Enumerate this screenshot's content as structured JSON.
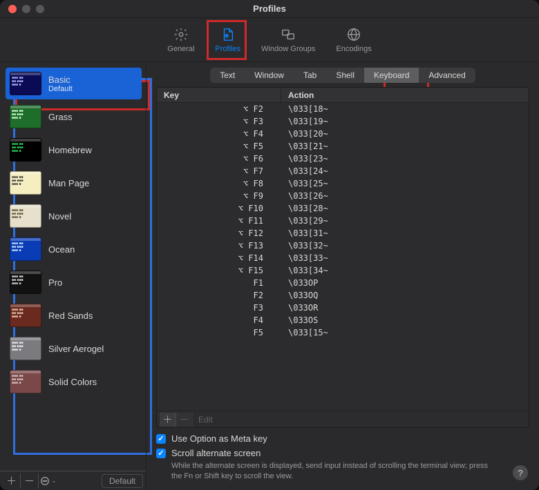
{
  "window": {
    "title": "Profiles"
  },
  "toolbar": {
    "items": [
      {
        "id": "general",
        "label": "General"
      },
      {
        "id": "profiles",
        "label": "Profiles",
        "active": true
      },
      {
        "id": "window-groups",
        "label": "Window Groups"
      },
      {
        "id": "encodings",
        "label": "Encodings"
      }
    ]
  },
  "sidebar": {
    "items": [
      {
        "name": "Basic",
        "sub": "Default",
        "selected": true,
        "swatch": {
          "bg": "#0a0a55",
          "fg": "#bcbcff"
        }
      },
      {
        "name": "Grass",
        "swatch": {
          "bg": "#1e6d2b",
          "fg": "#d6ffd6"
        }
      },
      {
        "name": "Homebrew",
        "swatch": {
          "bg": "#000000",
          "fg": "#2ee05a"
        }
      },
      {
        "name": "Man Page",
        "swatch": {
          "bg": "#f5eec0",
          "fg": "#333333"
        }
      },
      {
        "name": "Novel",
        "swatch": {
          "bg": "#e6e0cc",
          "fg": "#5a4a2a"
        }
      },
      {
        "name": "Ocean",
        "swatch": {
          "bg": "#0a3db5",
          "fg": "#cfe3ff"
        }
      },
      {
        "name": "Pro",
        "swatch": {
          "bg": "#111111",
          "fg": "#dddddd"
        }
      },
      {
        "name": "Red Sands",
        "swatch": {
          "bg": "#6a2a1f",
          "fg": "#f0d0b6"
        }
      },
      {
        "name": "Silver Aerogel",
        "swatch": {
          "bg": "#7a7a7f",
          "fg": "#efefef"
        }
      },
      {
        "name": "Solid Colors",
        "swatch": {
          "bg": "#7a4848",
          "fg": "#d8c8c8"
        }
      }
    ],
    "footer": {
      "default_btn": "Default"
    }
  },
  "panel": {
    "seg": [
      {
        "label": "Text"
      },
      {
        "label": "Window"
      },
      {
        "label": "Tab"
      },
      {
        "label": "Shell"
      },
      {
        "label": "Keyboard",
        "active": true
      },
      {
        "label": "Advanced"
      }
    ],
    "table": {
      "headers": {
        "key": "Key",
        "action": "Action"
      },
      "rows": [
        {
          "key": "⌥ F2",
          "action": "\\033[18~"
        },
        {
          "key": "⌥ F3",
          "action": "\\033[19~"
        },
        {
          "key": "⌥ F4",
          "action": "\\033[20~"
        },
        {
          "key": "⌥ F5",
          "action": "\\033[21~"
        },
        {
          "key": "⌥ F6",
          "action": "\\033[23~"
        },
        {
          "key": "⌥ F7",
          "action": "\\033[24~"
        },
        {
          "key": "⌥ F8",
          "action": "\\033[25~"
        },
        {
          "key": "⌥ F9",
          "action": "\\033[26~"
        },
        {
          "key": "⌥ F10",
          "action": "\\033[28~"
        },
        {
          "key": "⌥ F11",
          "action": "\\033[29~"
        },
        {
          "key": "⌥ F12",
          "action": "\\033[31~"
        },
        {
          "key": "⌥ F13",
          "action": "\\033[32~"
        },
        {
          "key": "⌥ F14",
          "action": "\\033[33~"
        },
        {
          "key": "⌥ F15",
          "action": "\\033[34~"
        },
        {
          "key": "F1",
          "action": "\\033OP"
        },
        {
          "key": "F2",
          "action": "\\033OQ"
        },
        {
          "key": "F3",
          "action": "\\033OR"
        },
        {
          "key": "F4",
          "action": "\\033OS"
        },
        {
          "key": "F5",
          "action": "\\033[15~"
        }
      ],
      "footer": {
        "edit": "Edit"
      }
    },
    "checks": {
      "meta": "Use Option as Meta key",
      "scroll": "Scroll alternate screen",
      "note": "While the alternate screen is displayed, send input instead of scrolling the terminal view; press the Fn or Shift key to scroll the view."
    },
    "help": "?"
  }
}
